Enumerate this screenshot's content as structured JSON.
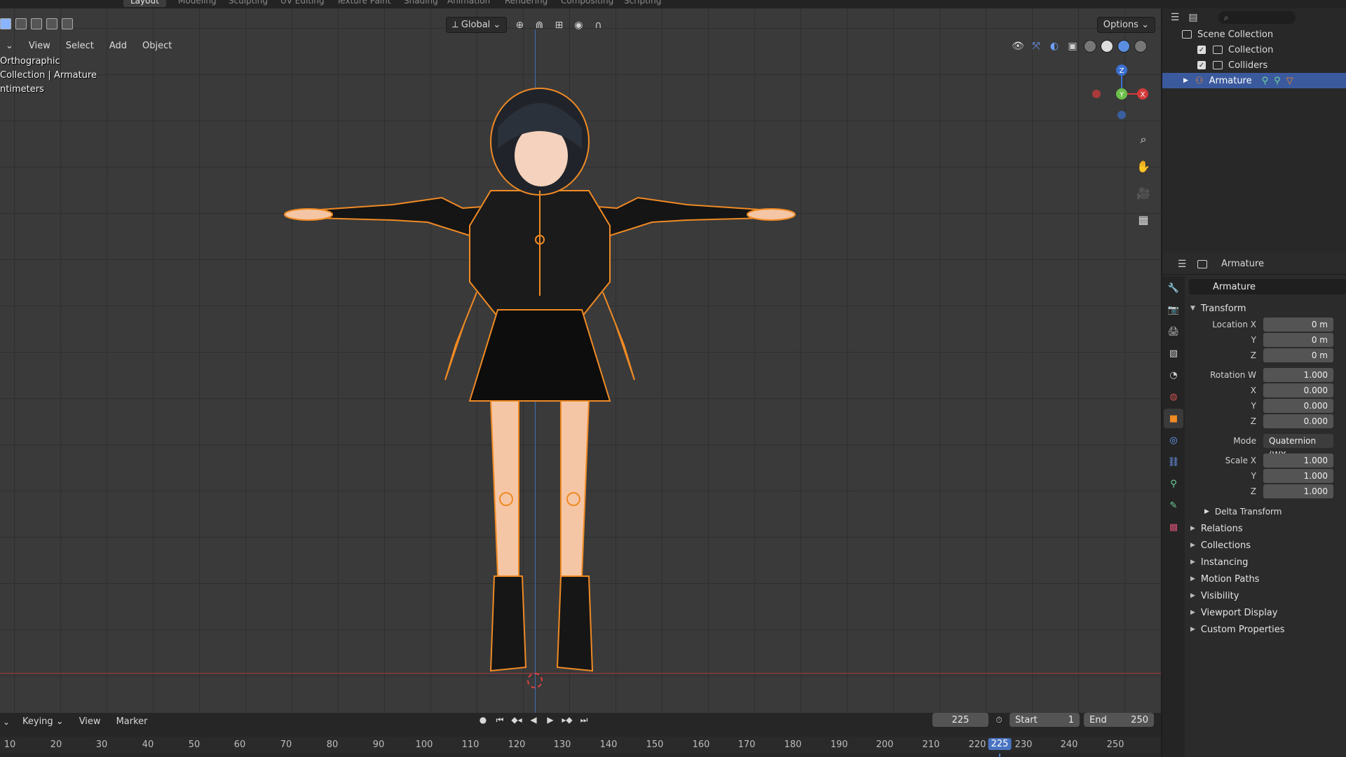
{
  "topbar": {
    "tabs": [
      "Layout",
      "Modeling",
      "Sculpting",
      "UV Editing",
      "Texture Paint",
      "Shading",
      "Animation",
      "Rendering",
      "Compositing",
      "Scripting"
    ],
    "active_tab": "Layout"
  },
  "viewport": {
    "menu": [
      "View",
      "Select",
      "Add",
      "Object"
    ],
    "transform_orientation": "Global",
    "options_label": "Options",
    "info_lines": [
      "Orthographic",
      "Collection | Armature",
      "ntimeters"
    ],
    "gizmo_axes": {
      "z": "Z",
      "y": "Y",
      "x": "X"
    }
  },
  "outliner": {
    "rows": [
      {
        "label": "Scene Collection"
      },
      {
        "label": "Collection"
      },
      {
        "label": "Colliders"
      },
      {
        "label": "Armature"
      }
    ]
  },
  "properties": {
    "header_title": "Armature",
    "object_name": "Armature",
    "transform_label": "Transform",
    "location": {
      "x_label": "Location X",
      "y_label": "Y",
      "z_label": "Z",
      "x": "0 m",
      "y": "0 m",
      "z": "0 m"
    },
    "rotation": {
      "w_label": "Rotation W",
      "x_label": "X",
      "y_label": "Y",
      "z_label": "Z",
      "w": "1.000",
      "x": "0.000",
      "y": "0.000",
      "z": "0.000"
    },
    "mode_label": "Mode",
    "mode_value": "Quaternion (WX",
    "scale": {
      "x_label": "Scale X",
      "y_label": "Y",
      "z_label": "Z",
      "x": "1.000",
      "y": "1.000",
      "z": "1.000"
    },
    "delta_transform": "Delta Transform",
    "sections": [
      "Relations",
      "Collections",
      "Instancing",
      "Motion Paths",
      "Visibility",
      "Viewport Display",
      "Custom Properties"
    ]
  },
  "timeline": {
    "menu": [
      "Keying",
      "View",
      "Marker"
    ],
    "current_frame": "225",
    "start_label": "Start",
    "start": "1",
    "end_label": "End",
    "end": "250",
    "ticks": [
      "10",
      "20",
      "30",
      "40",
      "50",
      "60",
      "70",
      "80",
      "90",
      "100",
      "110",
      "120",
      "130",
      "140",
      "150",
      "160",
      "170",
      "180",
      "190",
      "200",
      "210",
      "220",
      "225",
      "230",
      "240",
      "250"
    ]
  },
  "colors": {
    "accent": "#4a74c2",
    "selection": "#3b5a9e",
    "armature": "#f08a24",
    "floor_axis": "#a03838"
  }
}
